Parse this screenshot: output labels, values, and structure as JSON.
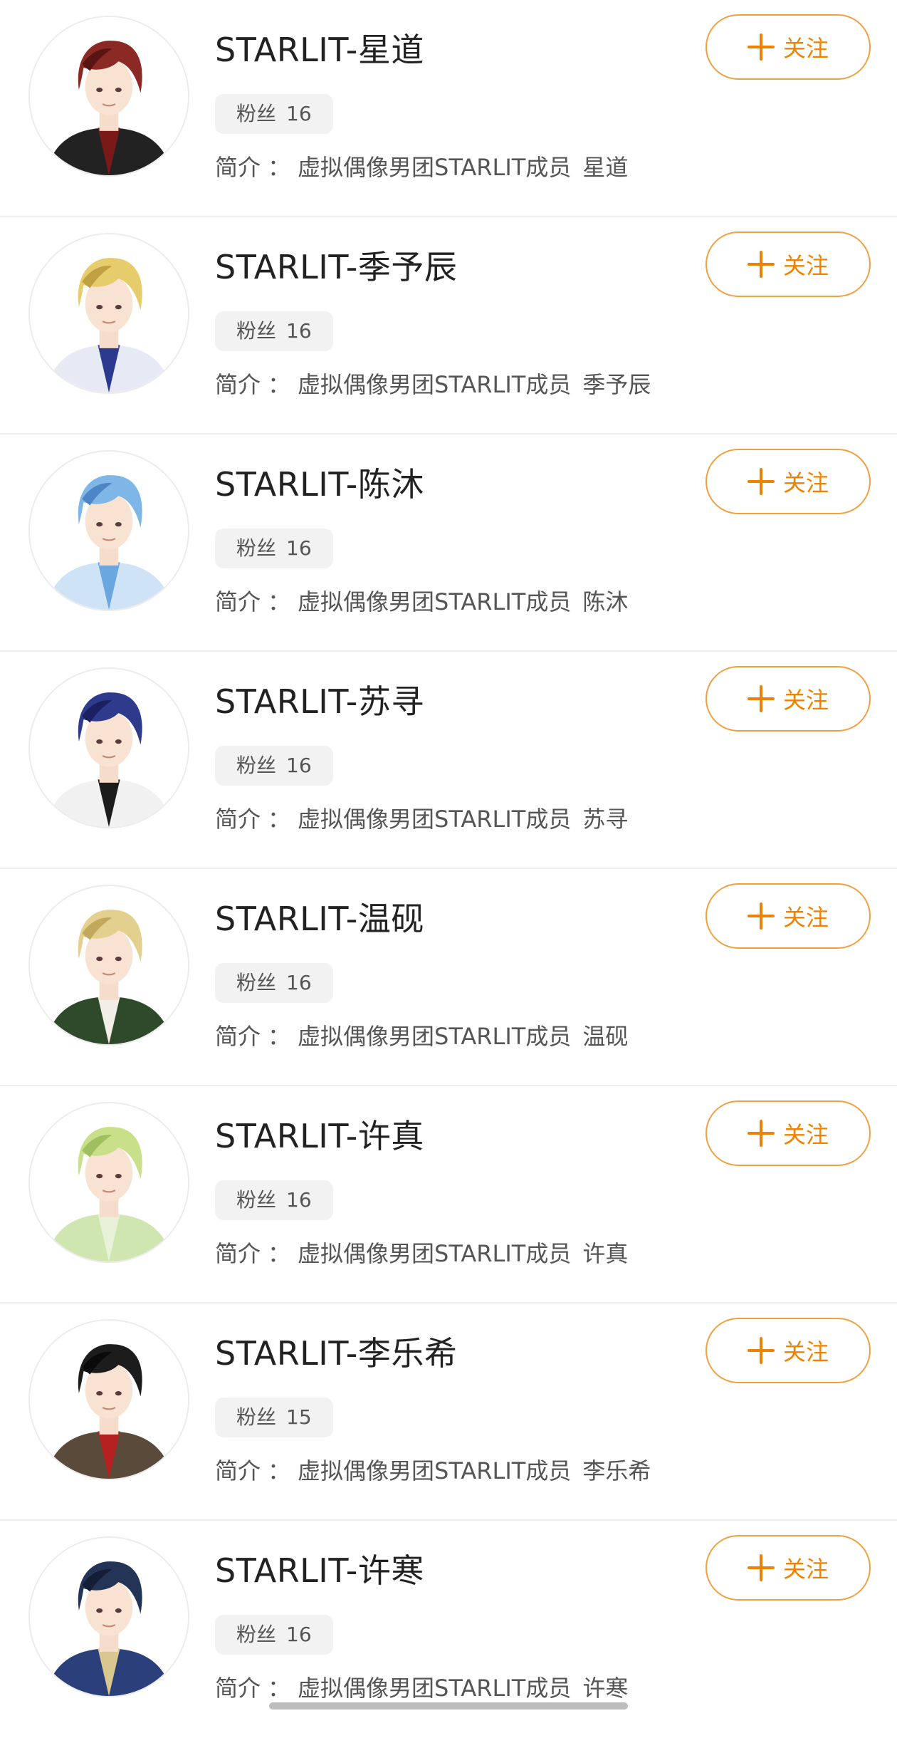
{
  "follow_label": "关注",
  "fans_label": "粉丝",
  "intro_label": "简介",
  "intro_sep": "：",
  "intro_prefix": "虚拟偶像男团STARLIT成员",
  "colors": {
    "accent": "#f08200",
    "button_border": "#f0a040",
    "badge_bg": "#f2f2f2",
    "divider": "#eeeeee"
  },
  "items": [
    {
      "name": "STARLIT-星道",
      "fans": "16",
      "member": "星道",
      "hair": "#8b2a24",
      "hair_dark": "#5a1512",
      "outfit": "#222222",
      "accent": "#7a1a18"
    },
    {
      "name": "STARLIT-季予辰",
      "fans": "16",
      "member": "季予辰",
      "hair": "#e6cc6a",
      "hair_dark": "#c0a040",
      "outfit": "#e6eaf4",
      "accent": "#2b3a8f"
    },
    {
      "name": "STARLIT-陈沐",
      "fans": "16",
      "member": "陈沐",
      "hair": "#7fb6e8",
      "hair_dark": "#4d86c4",
      "outfit": "#cfe3f7",
      "accent": "#6aa6e0"
    },
    {
      "name": "STARLIT-苏寻",
      "fans": "16",
      "member": "苏寻",
      "hair": "#2e3a8c",
      "hair_dark": "#1a2060",
      "outfit": "#f1f1f1",
      "accent": "#1c1c1c"
    },
    {
      "name": "STARLIT-温砚",
      "fans": "16",
      "member": "温砚",
      "hair": "#e3d08e",
      "hair_dark": "#c2a85c",
      "outfit": "#2f4a2a",
      "accent": "#f2f0e6"
    },
    {
      "name": "STARLIT-许真",
      "fans": "16",
      "member": "许真",
      "hair": "#c8e08a",
      "hair_dark": "#a0c060",
      "outfit": "#cfe6b0",
      "accent": "#e8f2d8"
    },
    {
      "name": "STARLIT-李乐希",
      "fans": "15",
      "member": "李乐希",
      "hair": "#1c1c1c",
      "hair_dark": "#0a0a0a",
      "outfit": "#5a4a3a",
      "accent": "#b52020"
    },
    {
      "name": "STARLIT-许寒",
      "fans": "16",
      "member": "许寒",
      "hair": "#243457",
      "hair_dark": "#141e38",
      "outfit": "#2b3f7a",
      "accent": "#d8c890"
    }
  ]
}
